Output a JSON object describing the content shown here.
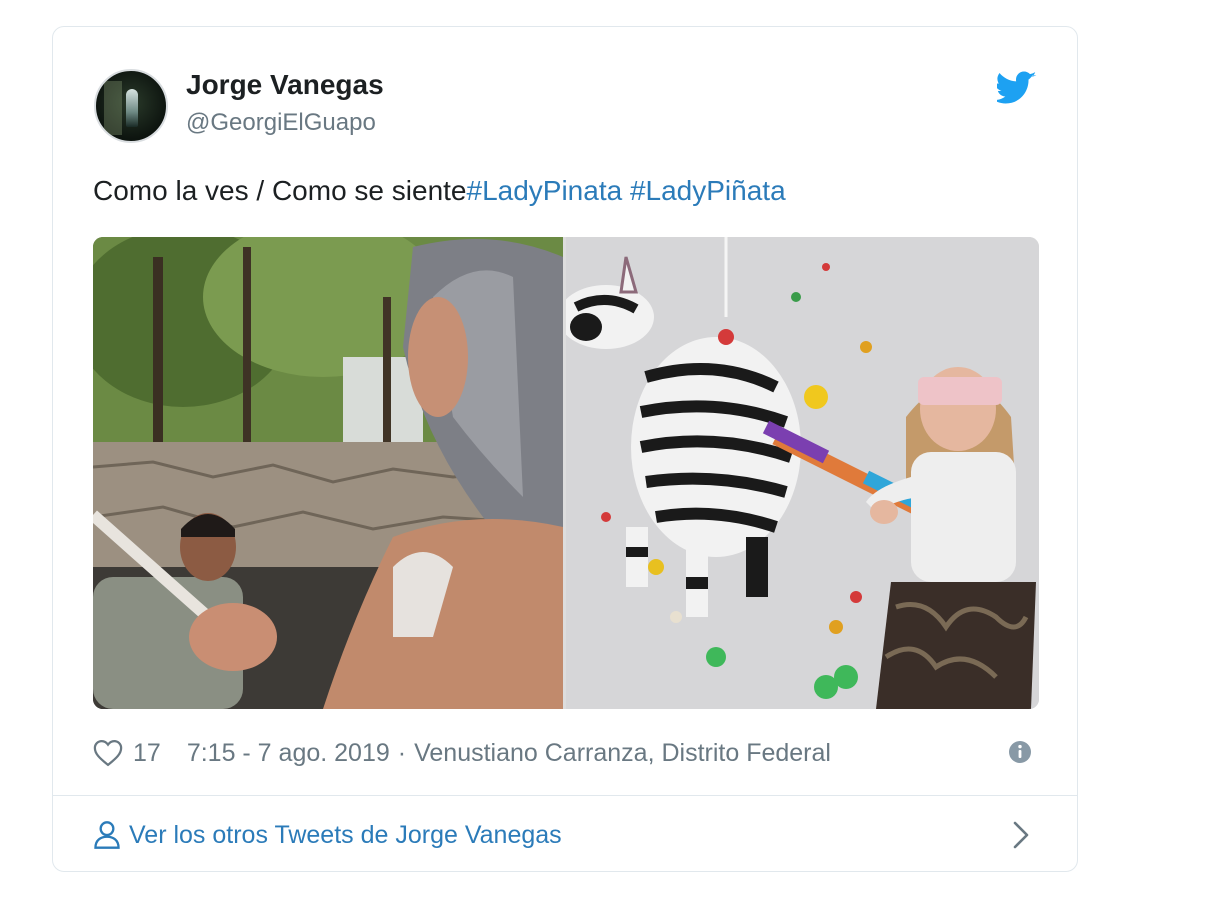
{
  "tweet": {
    "author": {
      "display_name": "Jorge Vanegas",
      "handle": "@GeorgiElGuapo"
    },
    "text": {
      "plain": "Como la ves / Como se siente",
      "hashtags": [
        "#LadyPinata",
        "#LadyPiñata"
      ]
    },
    "media": {
      "left_image": "man-with-stick-and-woman-image",
      "right_image": "girl-blindfolded-hitting-zebra-pinata-image"
    },
    "meta": {
      "like_count": "17",
      "timestamp": "7:15 - 7 ago. 2019",
      "separator": "·",
      "location": "Venustiano Carranza, Distrito Federal"
    },
    "footer": {
      "link_text": "Ver los otros Tweets de Jorge Vanegas"
    }
  },
  "icons": {
    "brand": "twitter-bird-icon",
    "like": "heart-icon",
    "info": "info-icon",
    "profile": "person-icon",
    "more": "chevron-right-icon"
  },
  "colors": {
    "link": "#2b7bb9",
    "twitter_blue": "#1da1f2",
    "text": "#1c2022",
    "muted": "#697882",
    "border": "#e1e8ed"
  }
}
